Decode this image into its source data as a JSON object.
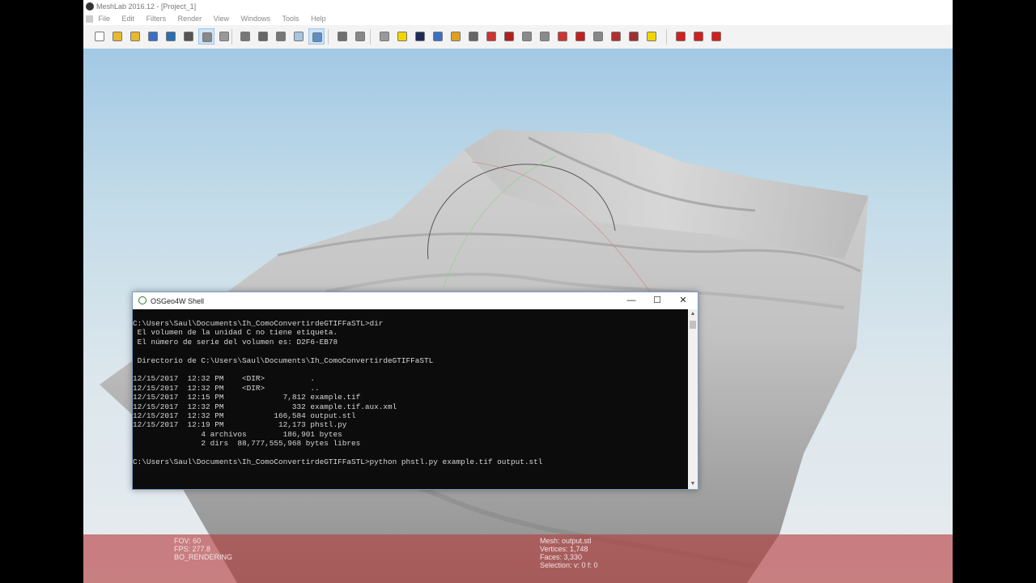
{
  "app": {
    "title": "MeshLab 2016.12 - [Project_1]"
  },
  "menu": [
    "File",
    "Edit",
    "Filters",
    "Render",
    "View",
    "Windows",
    "Tools",
    "Help"
  ],
  "toolbar": {
    "buttons": [
      {
        "name": "new-project-icon",
        "color": "#ffffff"
      },
      {
        "name": "open-project-icon",
        "color": "#e8b830"
      },
      {
        "name": "import-mesh-icon",
        "color": "#e8b830"
      },
      {
        "name": "reload-icon",
        "color": "#3b6fc4"
      },
      {
        "name": "export-mesh-icon",
        "color": "#2a6fb0"
      },
      {
        "name": "snapshot-icon",
        "color": "#555555"
      },
      {
        "name": "layers-icon",
        "color": "#888888",
        "active": true
      },
      {
        "name": "raster-layers-icon",
        "color": "#999999"
      },
      {
        "name": "bounding-box-icon",
        "color": "#777777"
      },
      {
        "name": "points-icon",
        "color": "#666666"
      },
      {
        "name": "wireframe-icon",
        "color": "#777777"
      },
      {
        "name": "flat-shading-icon",
        "color": "#a8c4e0"
      },
      {
        "name": "smooth-shading-icon",
        "color": "#5d8fc7",
        "active": true
      },
      {
        "name": "light-on-icon",
        "color": "#6f6f6f"
      },
      {
        "name": "double-side-light-icon",
        "color": "#888888"
      },
      {
        "name": "trackball-icon",
        "color": "#999999"
      },
      {
        "name": "annotation-a-icon",
        "color": "#f2d400"
      },
      {
        "name": "mesh-info-icon",
        "color": "#1f2a55"
      },
      {
        "name": "measure-tool-icon",
        "color": "#3b6fc4"
      },
      {
        "name": "pick-points-icon",
        "color": "#e0a020"
      },
      {
        "name": "align-icon",
        "color": "#666666"
      },
      {
        "name": "paint-brush-icon",
        "color": "#cc3333"
      },
      {
        "name": "color-paint-icon",
        "color": "#b02020"
      },
      {
        "name": "select-faces-icon",
        "color": "#8a8a8a"
      },
      {
        "name": "select-vertices-icon",
        "color": "#8a8a8a"
      },
      {
        "name": "select-connected-icon",
        "color": "#cc3333"
      },
      {
        "name": "georef-icon",
        "color": "#c02020"
      },
      {
        "name": "select-box-icon",
        "color": "#888888"
      },
      {
        "name": "z-paint-icon",
        "color": "#b03030"
      },
      {
        "name": "quality-map-icon",
        "color": "#a03030"
      },
      {
        "name": "about-info-icon",
        "color": "#f2d400"
      },
      {
        "name": "delete-faces-icon",
        "color": "#d02020"
      },
      {
        "name": "delete-vertices-icon",
        "color": "#d02020"
      },
      {
        "name": "delete-all-selected-icon",
        "color": "#d02020"
      }
    ]
  },
  "info": {
    "fov": "FOV: 60",
    "fps": "FPS:   277.8",
    "mode": "BO_RENDERING",
    "mesh": "Mesh: output.stl",
    "vertices": "Vertices: 1,748",
    "faces": "Faces: 3,330",
    "selection": "Selection: v: 0 f: 0"
  },
  "shell": {
    "title": "OSGeo4W Shell",
    "minimize": "—",
    "maximize": "☐",
    "close": "✕",
    "lines": [
      "C:\\Users\\Saul\\Documents\\Ih_ComoConvertirdeGTIFFaSTL>dir",
      " El volumen de la unidad C no tiene etiqueta.",
      " El número de serie del volumen es: D2F6-EB78",
      "",
      " Directorio de C:\\Users\\Saul\\Documents\\Ih_ComoConvertirdeGTIFFaSTL",
      "",
      "12/15/2017  12:32 PM    <DIR>          .",
      "12/15/2017  12:32 PM    <DIR>          ..",
      "12/15/2017  12:15 PM             7,812 example.tif",
      "12/15/2017  12:32 PM               332 example.tif.aux.xml",
      "12/15/2017  12:32 PM           166,584 output.stl",
      "12/15/2017  12:19 PM            12,173 phstl.py",
      "               4 archivos        186,901 bytes",
      "               2 dirs  88,777,555,968 bytes libres",
      "",
      "C:\\Users\\Saul\\Documents\\Ih_ComoConvertirdeGTIFFaSTL>python phstl.py example.tif output.stl"
    ]
  }
}
